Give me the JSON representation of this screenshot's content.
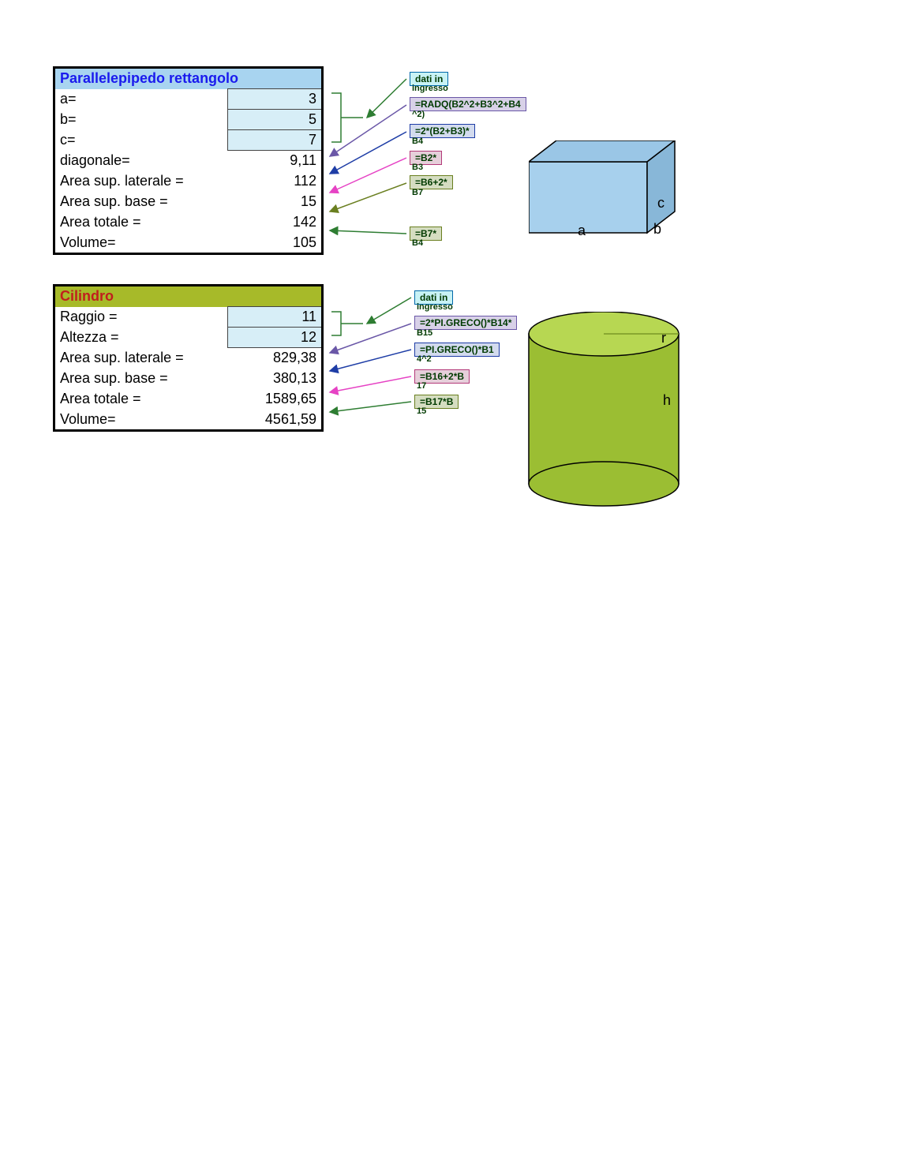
{
  "section1": {
    "title": "Parallelepipedo rettangolo",
    "rows": [
      {
        "label": "a=",
        "value": "3",
        "input": true
      },
      {
        "label": "b=",
        "value": "5",
        "input": true
      },
      {
        "label": "c=",
        "value": "7",
        "input": true
      },
      {
        "label": "diagonale=",
        "value": "9,11"
      },
      {
        "label": "Area sup. laterale =",
        "value": "112"
      },
      {
        "label": "Area sup. base =",
        "value": "15"
      },
      {
        "label": "Area totale =",
        "value": "142"
      },
      {
        "label": "Volume=",
        "value": "105"
      }
    ],
    "formulas": {
      "input_label": {
        "main": "dati in",
        "sub": "ingresso"
      },
      "diag": {
        "main": "=RADQ(B2^2+B3^2+B4",
        "sub": "^2)"
      },
      "lat": {
        "main": "=2*(B2+B3)*",
        "sub": "B4"
      },
      "base": {
        "main": "=B2*",
        "sub": "B3"
      },
      "tot": {
        "main": "=B6+2*",
        "sub": "B7"
      },
      "vol": {
        "main": "=B7*",
        "sub": "B4"
      }
    },
    "dimlabels": {
      "a": "a",
      "b": "b",
      "c": "c"
    }
  },
  "section2": {
    "title": "Cilindro",
    "rows": [
      {
        "label": "Raggio =",
        "value": "11",
        "input": true
      },
      {
        "label": "Altezza =",
        "value": "12",
        "input": true
      },
      {
        "label": "Area sup. laterale =",
        "value": "829,38"
      },
      {
        "label": "Area sup. base =",
        "value": "380,13"
      },
      {
        "label": "Area totale =",
        "value": "1589,65"
      },
      {
        "label": "Volume=",
        "value": "4561,59"
      }
    ],
    "formulas": {
      "input_label": {
        "main": "dati in",
        "sub": "ingresso"
      },
      "lat": {
        "main": "=2*PI.GRECO()*B14*",
        "sub": "B15"
      },
      "base": {
        "main": "=PI.GRECO()*B1",
        "sub": "4^2"
      },
      "tot": {
        "main": "=B16+2*B",
        "sub": "17"
      },
      "vol": {
        "main": "=B17*B",
        "sub": "15"
      }
    },
    "dimlabels": {
      "r": "r",
      "h": "h"
    }
  }
}
